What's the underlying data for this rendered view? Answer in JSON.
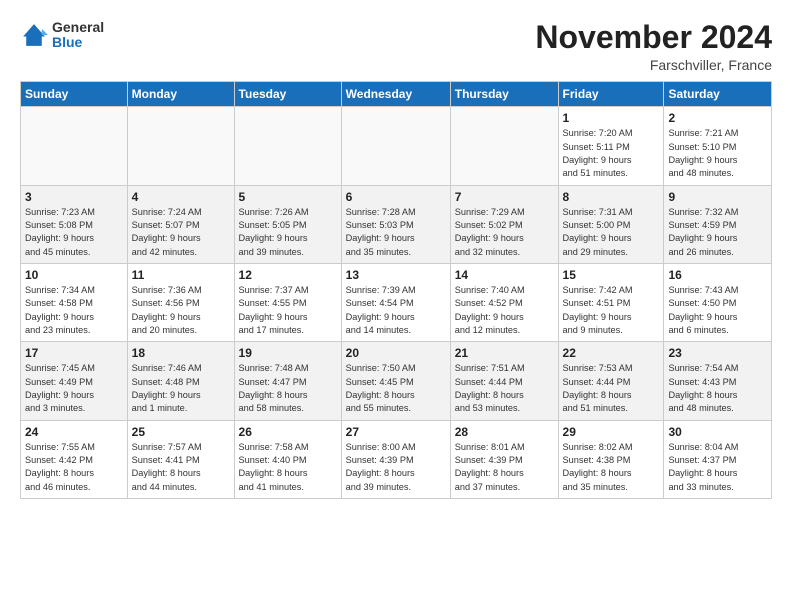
{
  "header": {
    "logo_general": "General",
    "logo_blue": "Blue",
    "month_title": "November 2024",
    "location": "Farschviller, France"
  },
  "weekdays": [
    "Sunday",
    "Monday",
    "Tuesday",
    "Wednesday",
    "Thursday",
    "Friday",
    "Saturday"
  ],
  "weeks": [
    [
      {
        "day": "",
        "info": ""
      },
      {
        "day": "",
        "info": ""
      },
      {
        "day": "",
        "info": ""
      },
      {
        "day": "",
        "info": ""
      },
      {
        "day": "",
        "info": ""
      },
      {
        "day": "1",
        "info": "Sunrise: 7:20 AM\nSunset: 5:11 PM\nDaylight: 9 hours\nand 51 minutes."
      },
      {
        "day": "2",
        "info": "Sunrise: 7:21 AM\nSunset: 5:10 PM\nDaylight: 9 hours\nand 48 minutes."
      }
    ],
    [
      {
        "day": "3",
        "info": "Sunrise: 7:23 AM\nSunset: 5:08 PM\nDaylight: 9 hours\nand 45 minutes."
      },
      {
        "day": "4",
        "info": "Sunrise: 7:24 AM\nSunset: 5:07 PM\nDaylight: 9 hours\nand 42 minutes."
      },
      {
        "day": "5",
        "info": "Sunrise: 7:26 AM\nSunset: 5:05 PM\nDaylight: 9 hours\nand 39 minutes."
      },
      {
        "day": "6",
        "info": "Sunrise: 7:28 AM\nSunset: 5:03 PM\nDaylight: 9 hours\nand 35 minutes."
      },
      {
        "day": "7",
        "info": "Sunrise: 7:29 AM\nSunset: 5:02 PM\nDaylight: 9 hours\nand 32 minutes."
      },
      {
        "day": "8",
        "info": "Sunrise: 7:31 AM\nSunset: 5:00 PM\nDaylight: 9 hours\nand 29 minutes."
      },
      {
        "day": "9",
        "info": "Sunrise: 7:32 AM\nSunset: 4:59 PM\nDaylight: 9 hours\nand 26 minutes."
      }
    ],
    [
      {
        "day": "10",
        "info": "Sunrise: 7:34 AM\nSunset: 4:58 PM\nDaylight: 9 hours\nand 23 minutes."
      },
      {
        "day": "11",
        "info": "Sunrise: 7:36 AM\nSunset: 4:56 PM\nDaylight: 9 hours\nand 20 minutes."
      },
      {
        "day": "12",
        "info": "Sunrise: 7:37 AM\nSunset: 4:55 PM\nDaylight: 9 hours\nand 17 minutes."
      },
      {
        "day": "13",
        "info": "Sunrise: 7:39 AM\nSunset: 4:54 PM\nDaylight: 9 hours\nand 14 minutes."
      },
      {
        "day": "14",
        "info": "Sunrise: 7:40 AM\nSunset: 4:52 PM\nDaylight: 9 hours\nand 12 minutes."
      },
      {
        "day": "15",
        "info": "Sunrise: 7:42 AM\nSunset: 4:51 PM\nDaylight: 9 hours\nand 9 minutes."
      },
      {
        "day": "16",
        "info": "Sunrise: 7:43 AM\nSunset: 4:50 PM\nDaylight: 9 hours\nand 6 minutes."
      }
    ],
    [
      {
        "day": "17",
        "info": "Sunrise: 7:45 AM\nSunset: 4:49 PM\nDaylight: 9 hours\nand 3 minutes."
      },
      {
        "day": "18",
        "info": "Sunrise: 7:46 AM\nSunset: 4:48 PM\nDaylight: 9 hours\nand 1 minute."
      },
      {
        "day": "19",
        "info": "Sunrise: 7:48 AM\nSunset: 4:47 PM\nDaylight: 8 hours\nand 58 minutes."
      },
      {
        "day": "20",
        "info": "Sunrise: 7:50 AM\nSunset: 4:45 PM\nDaylight: 8 hours\nand 55 minutes."
      },
      {
        "day": "21",
        "info": "Sunrise: 7:51 AM\nSunset: 4:44 PM\nDaylight: 8 hours\nand 53 minutes."
      },
      {
        "day": "22",
        "info": "Sunrise: 7:53 AM\nSunset: 4:44 PM\nDaylight: 8 hours\nand 51 minutes."
      },
      {
        "day": "23",
        "info": "Sunrise: 7:54 AM\nSunset: 4:43 PM\nDaylight: 8 hours\nand 48 minutes."
      }
    ],
    [
      {
        "day": "24",
        "info": "Sunrise: 7:55 AM\nSunset: 4:42 PM\nDaylight: 8 hours\nand 46 minutes."
      },
      {
        "day": "25",
        "info": "Sunrise: 7:57 AM\nSunset: 4:41 PM\nDaylight: 8 hours\nand 44 minutes."
      },
      {
        "day": "26",
        "info": "Sunrise: 7:58 AM\nSunset: 4:40 PM\nDaylight: 8 hours\nand 41 minutes."
      },
      {
        "day": "27",
        "info": "Sunrise: 8:00 AM\nSunset: 4:39 PM\nDaylight: 8 hours\nand 39 minutes."
      },
      {
        "day": "28",
        "info": "Sunrise: 8:01 AM\nSunset: 4:39 PM\nDaylight: 8 hours\nand 37 minutes."
      },
      {
        "day": "29",
        "info": "Sunrise: 8:02 AM\nSunset: 4:38 PM\nDaylight: 8 hours\nand 35 minutes."
      },
      {
        "day": "30",
        "info": "Sunrise: 8:04 AM\nSunset: 4:37 PM\nDaylight: 8 hours\nand 33 minutes."
      }
    ]
  ]
}
